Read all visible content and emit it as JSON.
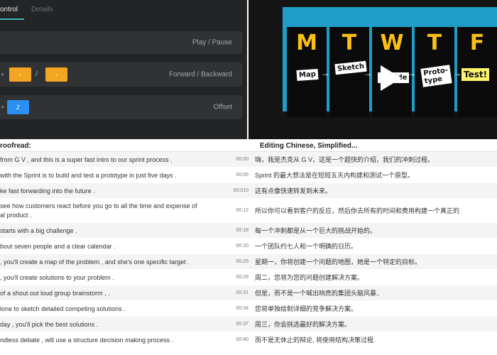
{
  "control_panel": {
    "tabs": [
      {
        "label": "ontrol"
      },
      {
        "label": "Details"
      }
    ],
    "rows": {
      "play": {
        "label": "Play / Pause"
      },
      "forward": {
        "prefix": "+",
        "key_back": "‹",
        "separator": "/",
        "key_forward": "›",
        "label": "Forward / Backward"
      },
      "offset": {
        "prefix": "+",
        "key": "Z",
        "label": "Offset"
      }
    },
    "colors": {
      "accent": "#3fb8b5",
      "orange_key": "#f4a623",
      "blue_key": "#2a8ff2"
    }
  },
  "video": {
    "days": [
      {
        "letter": "M",
        "step": "Map"
      },
      {
        "letter": "T",
        "step": "Sketch"
      },
      {
        "letter": "W",
        "step": "Decide"
      },
      {
        "letter": "T",
        "step": "Proto-\ntype"
      },
      {
        "letter": "F",
        "step": "Test!"
      }
    ],
    "play_icon": "play-triangle-icon"
  },
  "transcript": {
    "header_left": "roofread:",
    "header_right": "Editing Chinese, Simplified...",
    "rows": [
      {
        "source": "from G V , and this is a super fast intro to our sprint process .",
        "time": "00:00",
        "target": "嗨，我是杰克从 G V，这是一个超快的介绍，我们的冲刺过程。"
      },
      {
        "source": "with the Sprint is to build and test a prototype in just five days .",
        "time": "00:05",
        "target": "Sprint 的最大想法是在短短五天内构建和测试一个原型。"
      },
      {
        "source": "ke fast forwarding into the future .",
        "time": "00:010",
        "target": "这有点像快速转发到未来。"
      },
      {
        "source": "see how customers react before you go to all the time and expense of\nal product .",
        "time": "00:12",
        "target": "所以你可以看到客户的反应，然后你去所有的时间和费用构建一个真正的"
      },
      {
        "source": "starts with a big challenge .",
        "time": "00:18",
        "target": "每一个冲刺都是从一个巨大的挑战开始的。"
      },
      {
        "source": "bout seven people and a clear calendar .",
        "time": "00:20",
        "target": "一个团队约七人和一个明确的日历。"
      },
      {
        "source": ", you'll create a map of the problem , and she's one specific target .",
        "time": "00:25",
        "target": "星期一，你将创建一个问题的地图，她是一个特定的目标。"
      },
      {
        "source": ", you'll create solutions to your problem .",
        "time": "00:29",
        "target": "周二，您将为您的问题创建解决方案。"
      },
      {
        "source": "of a shout out loud group brainstorm , .",
        "time": "00:31",
        "target": "但是，而不是一个喊出响亮的集团头脑风暴,."
      },
      {
        "source": "lone to sketch detailed competing solutions .",
        "time": "00:34",
        "target": "您将单独绘制详细的竞争解决方案。"
      },
      {
        "source": "day , you'll pick the best solutions .",
        "time": "00:37",
        "target": "周三，你会挑选最好的解决方案。"
      },
      {
        "source": "ndless debate , will use a structure decision making process .",
        "time": "00:40",
        "target": "而不是无休止的辩论, 将使用结构决策过程."
      }
    ]
  }
}
